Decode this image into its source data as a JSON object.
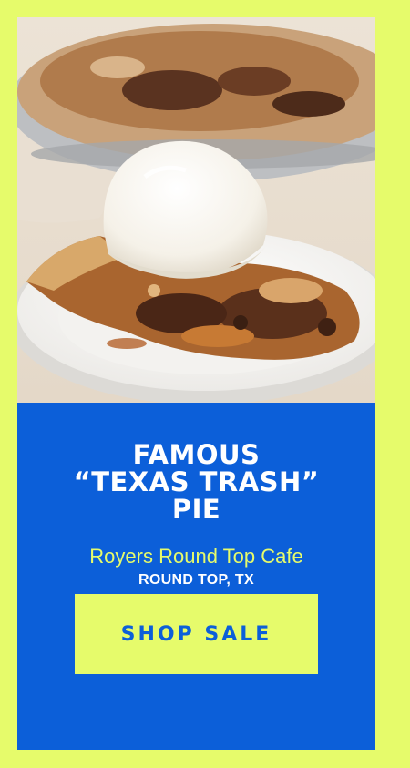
{
  "promo": {
    "title_lines": [
      "FAMOUS",
      "“TEXAS TRASH”",
      "PIE"
    ],
    "vendor": "Royers Round Top Cafe",
    "location": "ROUND TOP, TX",
    "cta_label": "SHOP SALE"
  },
  "colors": {
    "background": "#e6fb6b",
    "panel": "#0c5fd9",
    "accent": "#e6fb6b",
    "text": "#ffffff"
  }
}
